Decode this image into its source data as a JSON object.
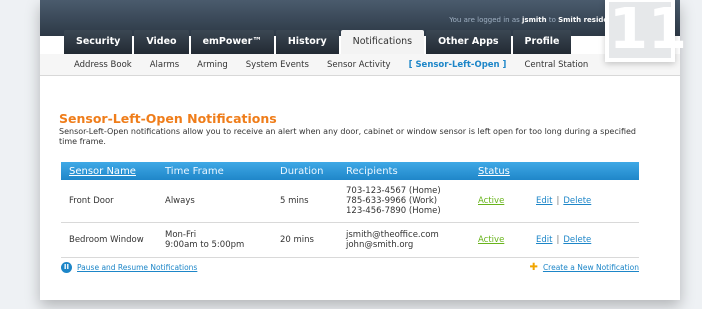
{
  "header": {
    "login_text": "You are logged in as",
    "user": "jsmith",
    "login_to": "to",
    "residence": "Smith residence"
  },
  "badge": {
    "number": "11"
  },
  "tabs": [
    {
      "label": "Security"
    },
    {
      "label": "Video"
    },
    {
      "label": "emPower™"
    },
    {
      "label": "History"
    },
    {
      "label": "Notifications"
    },
    {
      "label": "Other Apps"
    },
    {
      "label": "Profile"
    }
  ],
  "subnav": [
    {
      "label": "Address Book"
    },
    {
      "label": "Alarms"
    },
    {
      "label": "Arming"
    },
    {
      "label": "System Events"
    },
    {
      "label": "Sensor Activity"
    },
    {
      "label": "[ Sensor-Left-Open ]"
    },
    {
      "label": "Central Station"
    }
  ],
  "page": {
    "title": "Sensor-Left-Open Notifications",
    "description": "Sensor-Left-Open notifications allow you to receive an alert when any door, cabinet or window sensor is left open for too long during a specified time frame."
  },
  "table": {
    "headers": {
      "sensor_name": "Sensor Name",
      "time_frame": "Time Frame",
      "duration": "Duration",
      "recipients": "Recipients",
      "status": "Status"
    },
    "rows": [
      {
        "sensor_name": "Front Door",
        "time_frame_1": "Always",
        "time_frame_2": "",
        "duration": "5 mins",
        "recipients": [
          "703-123-4567 (Home)",
          "785-633-9966 (Work)",
          "123-456-7890 (Home)"
        ],
        "status": "Active",
        "edit": "Edit",
        "separator": "|",
        "delete": "Delete"
      },
      {
        "sensor_name": "Bedroom Window",
        "time_frame_1": "Mon-Fri",
        "time_frame_2": "9:00am to 5:00pm",
        "duration": "20 mins",
        "recipients": [
          "jsmith@theoffice.com",
          "john@smith.org"
        ],
        "status": "Active",
        "edit": "Edit",
        "separator": "|",
        "delete": "Delete"
      }
    ]
  },
  "footer": {
    "pause_link": "Pause and Resume Notifications",
    "create_link": "Create a New Notification"
  },
  "colors": {
    "brand_orange": "#ef7d1a",
    "link_blue": "#1d86c8",
    "active_green": "#68b41b",
    "nav_dark": "#2d3946"
  }
}
